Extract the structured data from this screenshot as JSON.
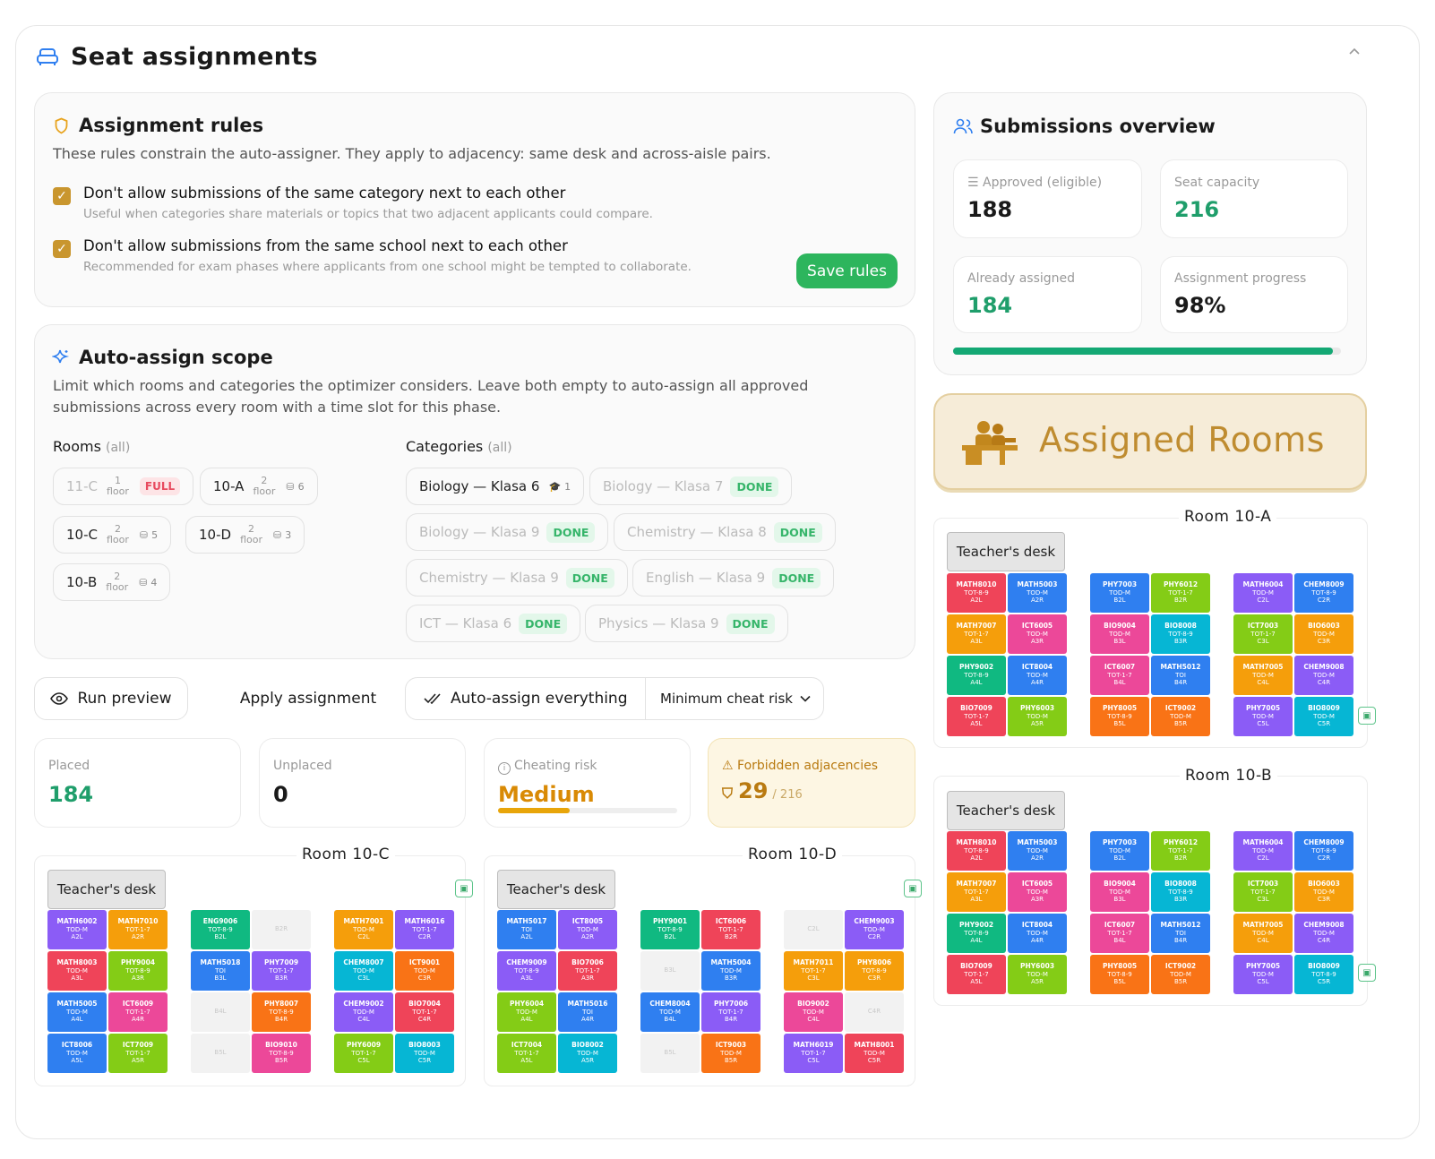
{
  "header": {
    "title": "Seat assignments"
  },
  "rules": {
    "title": "Assignment rules",
    "desc": "These rules constrain the auto-assigner. They apply to adjacency: same desk and across-aisle pairs.",
    "items": [
      {
        "label": "Don't allow submissions of the same category next to each other",
        "sub": "Useful when categories share materials or topics that two adjacent applicants could compare.",
        "checked": true
      },
      {
        "label": "Don't allow submissions from the same school next to each other",
        "sub": "Recommended for exam phases where applicants from one school might be tempted to collaborate.",
        "checked": true
      }
    ],
    "save_label": "Save rules"
  },
  "scope": {
    "title": "Auto-assign scope",
    "desc1": "Limit which rooms and categories the optimizer considers. Leave both empty to auto-assign all approved",
    "desc2": "submissions across every room with a time slot for this phase.",
    "rooms_label": "Rooms",
    "rooms_hint": "(all)",
    "categories_label": "Categories",
    "categories_hint": "(all)",
    "floor_word": "floor",
    "rooms": [
      {
        "name": "11-C",
        "floor": "1",
        "tag": "FULL"
      },
      {
        "name": "10-A",
        "floor": "2",
        "count": "6"
      },
      {
        "name": "10-C",
        "floor": "2",
        "count": "5"
      },
      {
        "name": "10-D",
        "floor": "2",
        "count": "3"
      },
      {
        "name": "10-B",
        "floor": "2",
        "count": "4"
      }
    ],
    "categories": [
      {
        "name": "Biology — Klasa 6",
        "count": "1"
      },
      {
        "name": "Biology — Klasa 7",
        "tag": "DONE"
      },
      {
        "name": "Biology — Klasa 9",
        "tag": "DONE"
      },
      {
        "name": "Chemistry — Klasa 8",
        "tag": "DONE"
      },
      {
        "name": "Chemistry — Klasa 9",
        "tag": "DONE"
      },
      {
        "name": "English — Klasa 9",
        "tag": "DONE"
      },
      {
        "name": "ICT — Klasa 6",
        "tag": "DONE"
      },
      {
        "name": "Physics — Klasa 9",
        "tag": "DONE"
      }
    ]
  },
  "actions": {
    "preview": "Run preview",
    "apply": "Apply assignment",
    "auto": "Auto-assign everything",
    "mode": "Minimum cheat risk"
  },
  "results": {
    "placed_label": "Placed",
    "placed": "184",
    "unplaced_label": "Unplaced",
    "unplaced": "0",
    "risk_label": "Cheating risk",
    "risk": "Medium",
    "risk_level": 0.4,
    "forbidden_label": "Forbidden adjacencies",
    "forbidden": "29",
    "forbidden_total": "/ 216"
  },
  "overview": {
    "title": "Submissions overview",
    "approved_label": "Approved (eligible)",
    "approved": "188",
    "capacity_label": "Seat capacity",
    "capacity": "216",
    "assigned_label": "Already assigned",
    "assigned": "184",
    "progress_label": "Assignment progress",
    "progress": "98%",
    "progress_value": 0.98
  },
  "assigned_banner": "Assigned Rooms",
  "teacher_desk": "Teacher's desk",
  "colors": {
    "green": "#2db55d",
    "accent": "#1f9e6b",
    "gold": "#c9962e",
    "blue": "#2f7ff0",
    "purple": "#8b5cf6",
    "orange": "#f59e0b",
    "pink": "#ec4899",
    "teal": "#06b6d4",
    "red": "#ef4459",
    "lime": "#84cc16",
    "emerald": "#10b981",
    "deep": "#f97316"
  },
  "rooms": {
    "r10c": {
      "name": "Room 10-C",
      "seats": [
        [
          "MATH6002",
          "TOD-M",
          "A2L",
          "purple"
        ],
        [
          "MATH7010",
          "TOT-1-7",
          "A2R",
          "orange"
        ],
        [
          "ENG9006",
          "TOT-8-9",
          "B2L",
          "emerald"
        ],
        [
          "",
          "",
          "B2R",
          "empty"
        ],
        [
          "MATH7001",
          "TOD-M",
          "C2L",
          "orange"
        ],
        [
          "MATH6016",
          "TOT-1-7",
          "C2R",
          "purple"
        ],
        [
          "MATH8003",
          "TOD-M",
          "A3L",
          "red"
        ],
        [
          "PHY9004",
          "TOT-8-9",
          "A3R",
          "lime"
        ],
        [
          "MATH5018",
          "TOI",
          "B3L",
          "blue"
        ],
        [
          "PHY7009",
          "TOT-1-7",
          "B3R",
          "purple"
        ],
        [
          "CHEM8007",
          "TOD-M",
          "C3L",
          "teal"
        ],
        [
          "ICT9001",
          "TOD-M",
          "C3R",
          "deep"
        ],
        [
          "MATH5005",
          "TOD-M",
          "A4L",
          "blue"
        ],
        [
          "ICT6009",
          "TOT-1-7",
          "A4R",
          "pink"
        ],
        [
          "",
          "",
          "B4L",
          "empty"
        ],
        [
          "PHY8007",
          "TOT-8-9",
          "B4R",
          "deep"
        ],
        [
          "CHEM9002",
          "TOD-M",
          "C4L",
          "purple"
        ],
        [
          "BIO7004",
          "TOT-1-7",
          "C4R",
          "red"
        ],
        [
          "ICT8006",
          "TOD-M",
          "A5L",
          "blue"
        ],
        [
          "ICT7009",
          "TOT-1-7",
          "A5R",
          "lime"
        ],
        [
          "",
          "",
          "B5L",
          "empty"
        ],
        [
          "BIO9010",
          "TOT-8-9",
          "B5R",
          "pink"
        ],
        [
          "PHY6009",
          "TOT-1-7",
          "C5L",
          "lime"
        ],
        [
          "BIO8003",
          "TOD-M",
          "C5R",
          "teal"
        ]
      ]
    },
    "r10d": {
      "name": "Room 10-D",
      "seats": [
        [
          "MATH5017",
          "TOI",
          "A2L",
          "blue"
        ],
        [
          "ICT8005",
          "TOD-M",
          "A2R",
          "purple"
        ],
        [
          "PHY9001",
          "TOT-8-9",
          "B2L",
          "emerald"
        ],
        [
          "ICT6006",
          "TOT-1-7",
          "B2R",
          "red"
        ],
        [
          "",
          "",
          "C2L",
          "empty"
        ],
        [
          "CHEM9003",
          "TOD-M",
          "C2R",
          "purple"
        ],
        [
          "CHEM9009",
          "TOT-8-9",
          "A3L",
          "purple"
        ],
        [
          "BIO7006",
          "TOT-1-7",
          "A3R",
          "red"
        ],
        [
          "",
          "",
          "B3L",
          "empty"
        ],
        [
          "MATH5004",
          "TOD-M",
          "B3R",
          "blue"
        ],
        [
          "MATH7011",
          "TOT-1-7",
          "C3L",
          "orange"
        ],
        [
          "PHY8006",
          "TOT-8-9",
          "C3R",
          "orange"
        ],
        [
          "PHY6004",
          "TOD-M",
          "A4L",
          "lime"
        ],
        [
          "MATH5016",
          "TOI",
          "A4R",
          "blue"
        ],
        [
          "CHEM8004",
          "TOD-M",
          "B4L",
          "blue"
        ],
        [
          "PHY7006",
          "TOT-1-7",
          "B4R",
          "purple"
        ],
        [
          "BIO9002",
          "TOD-M",
          "C4L",
          "pink"
        ],
        [
          "",
          "",
          "C4R",
          "empty"
        ],
        [
          "ICT7004",
          "TOT-1-7",
          "A5L",
          "lime"
        ],
        [
          "BIO8002",
          "TOD-M",
          "A5R",
          "teal"
        ],
        [
          "",
          "",
          "B5L",
          "empty"
        ],
        [
          "ICT9003",
          "TOD-M",
          "B5R",
          "deep"
        ],
        [
          "MATH6019",
          "TOT-1-7",
          "C5L",
          "purple"
        ],
        [
          "MATH8001",
          "TOD-M",
          "C5R",
          "red"
        ]
      ]
    },
    "r10a": {
      "name": "Room 10-A",
      "seats": [
        [
          "MATH8010",
          "TOT-8-9",
          "A2L",
          "red"
        ],
        [
          "MATH5003",
          "TOD-M",
          "A2R",
          "blue"
        ],
        [
          "PHY7003",
          "TOD-M",
          "B2L",
          "blue"
        ],
        [
          "PHY6012",
          "TOT-1-7",
          "B2R",
          "lime"
        ],
        [
          "MATH6004",
          "TOD-M",
          "C2L",
          "purple"
        ],
        [
          "CHEM8009",
          "TOT-8-9",
          "C2R",
          "blue"
        ],
        [
          "MATH7007",
          "TOT-1-7",
          "A3L",
          "orange"
        ],
        [
          "ICT6005",
          "TOD-M",
          "A3R",
          "pink"
        ],
        [
          "BIO9004",
          "TOD-M",
          "B3L",
          "pink"
        ],
        [
          "BIO8008",
          "TOT-8-9",
          "B3R",
          "teal"
        ],
        [
          "ICT7003",
          "TOT-1-7",
          "C3L",
          "lime"
        ],
        [
          "BIO6003",
          "TOD-M",
          "C3R",
          "orange"
        ],
        [
          "PHY9002",
          "TOT-8-9",
          "A4L",
          "emerald"
        ],
        [
          "ICT8004",
          "TOD-M",
          "A4R",
          "blue"
        ],
        [
          "ICT6007",
          "TOT-1-7",
          "B4L",
          "pink"
        ],
        [
          "MATH5012",
          "TOI",
          "B4R",
          "blue"
        ],
        [
          "MATH7005",
          "TOD-M",
          "C4L",
          "orange"
        ],
        [
          "CHEM9008",
          "TOD-M",
          "C4R",
          "purple"
        ],
        [
          "BIO7009",
          "TOT-1-7",
          "A5L",
          "red"
        ],
        [
          "PHY6003",
          "TOD-M",
          "A5R",
          "lime"
        ],
        [
          "PHY8005",
          "TOT-8-9",
          "B5L",
          "deep"
        ],
        [
          "ICT9002",
          "TOD-M",
          "B5R",
          "deep"
        ],
        [
          "PHY7005",
          "TOD-M",
          "C5L",
          "purple"
        ],
        [
          "BIO8009",
          "TOD-M",
          "C5R",
          "teal"
        ]
      ]
    },
    "r10b": {
      "name": "Room 10-B",
      "seats": [
        [
          "MATH8010",
          "TOT-8-9",
          "A2L",
          "red"
        ],
        [
          "MATH5003",
          "TOD-M",
          "A2R",
          "blue"
        ],
        [
          "PHY7003",
          "TOD-M",
          "B2L",
          "blue"
        ],
        [
          "PHY6012",
          "TOT-1-7",
          "B2R",
          "lime"
        ],
        [
          "MATH6004",
          "TOD-M",
          "C2L",
          "purple"
        ],
        [
          "CHEM8009",
          "TOT-8-9",
          "C2R",
          "blue"
        ],
        [
          "MATH7007",
          "TOT-1-7",
          "A3L",
          "orange"
        ],
        [
          "ICT6005",
          "TOD-M",
          "A3R",
          "pink"
        ],
        [
          "BIO9004",
          "TOD-M",
          "B3L",
          "pink"
        ],
        [
          "BIO8008",
          "TOT-8-9",
          "B3R",
          "teal"
        ],
        [
          "ICT7003",
          "TOT-1-7",
          "C3L",
          "lime"
        ],
        [
          "BIO6003",
          "TOD-M",
          "C3R",
          "orange"
        ],
        [
          "PHY9002",
          "TOT-8-9",
          "A4L",
          "emerald"
        ],
        [
          "ICT8004",
          "TOD-M",
          "A4R",
          "blue"
        ],
        [
          "ICT6007",
          "TOT-1-7",
          "B4L",
          "pink"
        ],
        [
          "MATH5012",
          "TOI",
          "B4R",
          "blue"
        ],
        [
          "MATH7005",
          "TOD-M",
          "C4L",
          "orange"
        ],
        [
          "CHEM9008",
          "TOD-M",
          "C4R",
          "purple"
        ],
        [
          "BIO7009",
          "TOT-1-7",
          "A5L",
          "red"
        ],
        [
          "PHY6003",
          "TOD-M",
          "A5R",
          "lime"
        ],
        [
          "PHY8005",
          "TOT-8-9",
          "B5L",
          "deep"
        ],
        [
          "ICT9002",
          "TOD-M",
          "B5R",
          "deep"
        ],
        [
          "PHY7005",
          "TOD-M",
          "C5L",
          "purple"
        ],
        [
          "BIO8009",
          "TOT-8-9",
          "C5R",
          "teal"
        ]
      ]
    }
  }
}
